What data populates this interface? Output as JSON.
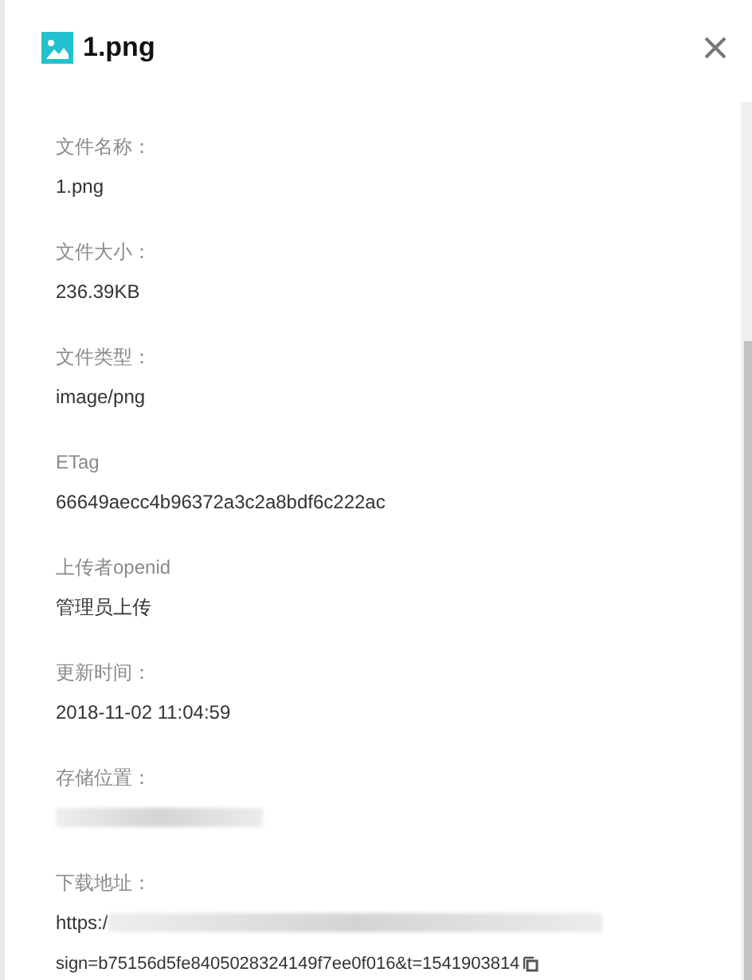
{
  "header": {
    "title": "1.png"
  },
  "fields": [
    {
      "kind": "text",
      "label": "文件名称：",
      "value": "1.png"
    },
    {
      "kind": "text",
      "label": "文件大小：",
      "value": "236.39KB"
    },
    {
      "kind": "text",
      "label": "文件类型：",
      "value": "image/png"
    },
    {
      "kind": "text",
      "label": "ETag",
      "value": "66649aecc4b96372a3c2a8bdf6c222ac"
    },
    {
      "kind": "text",
      "label": "上传者openid",
      "value": "管理员上传"
    },
    {
      "kind": "text",
      "label": "更新时间：",
      "value": "2018-11-02 11:04:59"
    },
    {
      "kind": "redacted",
      "label": "存储位置："
    },
    {
      "kind": "url",
      "label": "下载地址：",
      "value": "https:/",
      "continuation": "sign=b75156d5fe8405028324149f7ee0f016&t=1541903814"
    }
  ]
}
